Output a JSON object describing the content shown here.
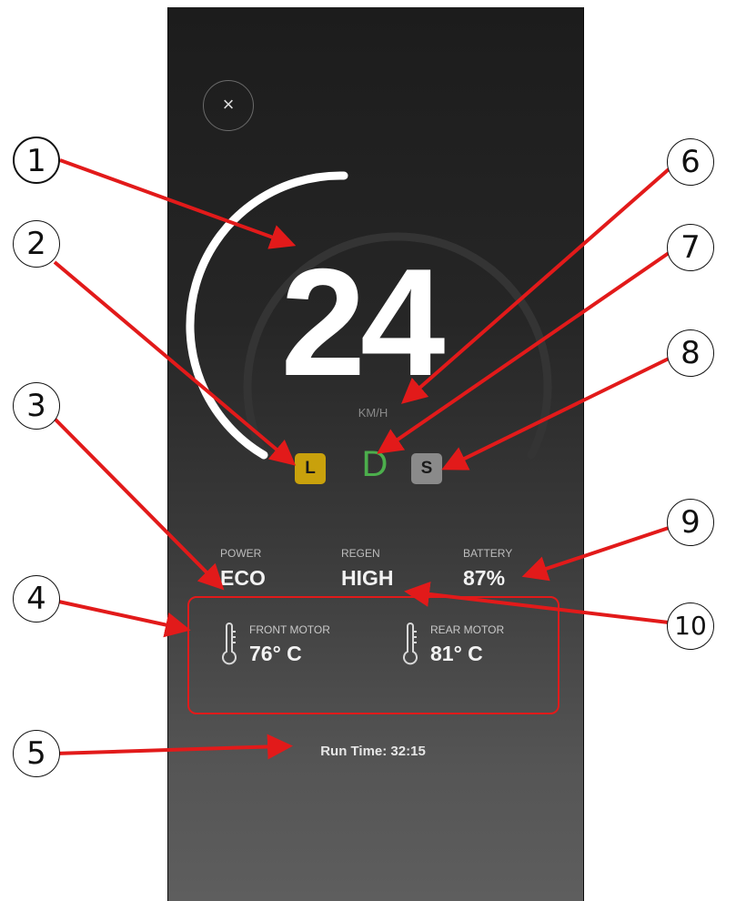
{
  "app": {
    "close_icon": "close-icon"
  },
  "speed": {
    "value": "24",
    "unit": "KM/H",
    "gauge_fraction": 0.35,
    "arc_color": "#ffffff",
    "track_color": "#3a3a3a"
  },
  "gears": {
    "low": {
      "label": "L",
      "color": "#c9a10c"
    },
    "drive": {
      "label": "D",
      "color": "#4cae4c"
    },
    "sport": {
      "label": "S",
      "color": "#8a8a8a"
    }
  },
  "stats": {
    "power": {
      "label": "POWER",
      "value": "ECO"
    },
    "regen": {
      "label": "REGEN",
      "value": "HIGH"
    },
    "battery": {
      "label": "BATTERY",
      "value": "87%"
    }
  },
  "motors": {
    "front": {
      "label": "FRONT MOTOR",
      "value": "76° C",
      "icon": "thermometer-icon"
    },
    "rear": {
      "label": "REAR MOTOR",
      "value": "81° C",
      "icon": "thermometer-icon"
    },
    "highlight_color": "#e21a1a"
  },
  "runtime": {
    "text": "Run Time: 32:15"
  },
  "callouts": [
    "1",
    "2",
    "3",
    "4",
    "5",
    "6",
    "7",
    "8",
    "9",
    "10"
  ],
  "annotation_color": "#e21a1a"
}
